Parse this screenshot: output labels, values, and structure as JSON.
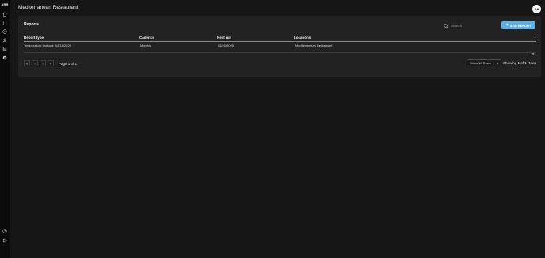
{
  "app": {
    "logo_text": "ARR",
    "page_title": "Mediterranean Restaurant",
    "avatar_initials": "GA"
  },
  "sidebar": {
    "items": [
      {
        "icon": "home-icon"
      },
      {
        "icon": "document-icon"
      },
      {
        "icon": "clock-icon"
      },
      {
        "icon": "user-icon"
      },
      {
        "icon": "report-icon",
        "active": true
      },
      {
        "icon": "badge-icon"
      }
    ],
    "bottom": [
      {
        "icon": "help-icon"
      },
      {
        "icon": "logout-icon"
      }
    ]
  },
  "reports": {
    "title": "Reports",
    "search_placeholder": "Search",
    "add_button_label": "ADD REPORT",
    "columns": [
      "Report type",
      "Cadence",
      "Next run",
      "Locations"
    ],
    "rows": [
      {
        "report_type": "Temperature logbook_04/18/2025",
        "cadence": "Monthly",
        "next_run": "06/20/2025",
        "locations": "Mediterranean Restaurant"
      }
    ],
    "pagination": {
      "page_info": "Page 1 of 1",
      "rows_select": "Show 10 Rows",
      "showing": "Showing 1 of 1 Rows"
    }
  },
  "colors": {
    "background": "#161616",
    "card": "#222222",
    "accent": "#5fb0e4"
  }
}
